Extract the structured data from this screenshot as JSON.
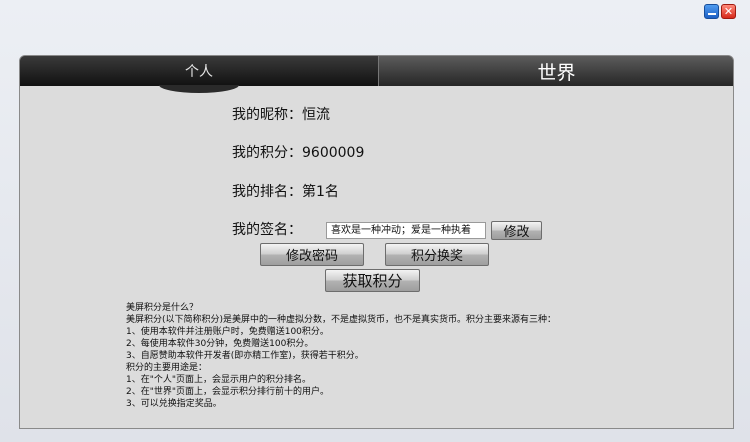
{
  "window": {
    "minimize_glyph": "",
    "close_glyph": "✕"
  },
  "tabs": {
    "personal": "个人",
    "world": "世界"
  },
  "profile": {
    "nickname": "我的昵称：恒流",
    "points": "我的积分：9600009",
    "rank": "我的排名：第1名",
    "signature_label": "我的签名：",
    "signature_value": "喜欢是一种冲动；爱是一种执着"
  },
  "buttons": {
    "edit": "修改",
    "change_password": "修改密码",
    "exchange_points": "积分换奖",
    "get_points": "获取积分"
  },
  "rules": [
    "美屏积分是什么？",
    "美屏积分(以下简称积分)是美屏中的一种虚拟分数，不是虚拟货币，也不是真实货币。积分主要来源有三种：",
    "1、使用本软件并注册账户时，免费赠送100积分。",
    "2、每使用本软件30分钟，免费赠送100积分。",
    "3、自愿赞助本软件开发者(即亦精工作室)，获得若干积分。",
    "积分的主要用途是：",
    "1、在\"个人\"页面上，会显示用户的积分排名。",
    "2、在\"世界\"页面上，会显示积分排行前十的用户。",
    "3、可以兑换指定奖品。"
  ]
}
